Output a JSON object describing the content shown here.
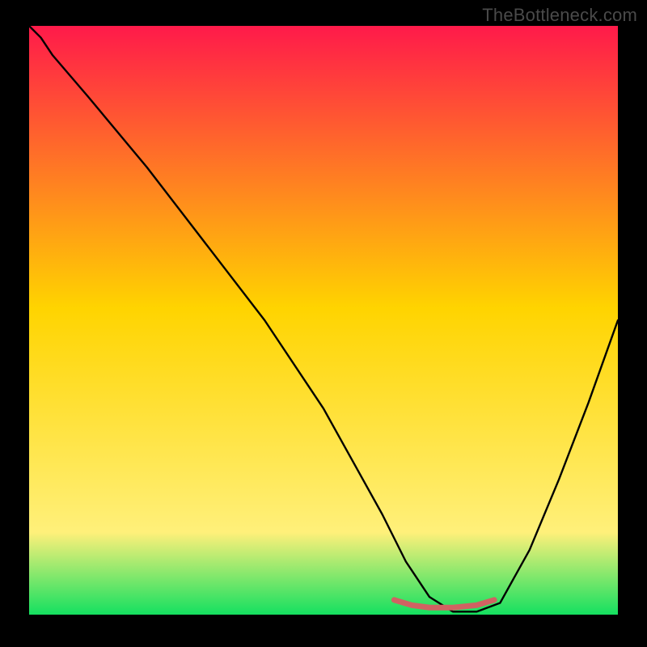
{
  "watermark": "TheBottleneck.com",
  "colors": {
    "curve_black": "#000000",
    "ideal_segment": "#d06262",
    "frame_black": "#000000",
    "grad_top": "#ff1a4a",
    "grad_mid": "#ffd400",
    "grad_yellow_light": "#fff07a",
    "grad_bottom": "#14e060"
  },
  "chart_data": {
    "type": "line",
    "title": "",
    "xlabel": "",
    "ylabel": "",
    "xlim": [
      0,
      100
    ],
    "ylim": [
      0,
      100
    ],
    "grid": false,
    "series": [
      {
        "name": "bottleneck-curve",
        "x": [
          0,
          2,
          4,
          10,
          20,
          30,
          40,
          50,
          55,
          60,
          64,
          68,
          72,
          76,
          80,
          85,
          90,
          95,
          100
        ],
        "y": [
          100,
          98,
          95,
          88,
          76,
          63,
          50,
          35,
          26,
          17,
          9,
          3,
          0.5,
          0.5,
          2,
          11,
          23,
          36,
          50
        ]
      },
      {
        "name": "ideal-range-segment",
        "x": [
          62,
          65,
          68,
          72,
          76,
          79
        ],
        "y": [
          2.5,
          1.6,
          1.2,
          1.2,
          1.6,
          2.5
        ]
      }
    ],
    "notes": "y-values represent percent bottleneck (0 = ideal, 100 = worst). V-shaped curve with minimum around x≈68–76. Red segment marks the near-zero ideal zone."
  }
}
